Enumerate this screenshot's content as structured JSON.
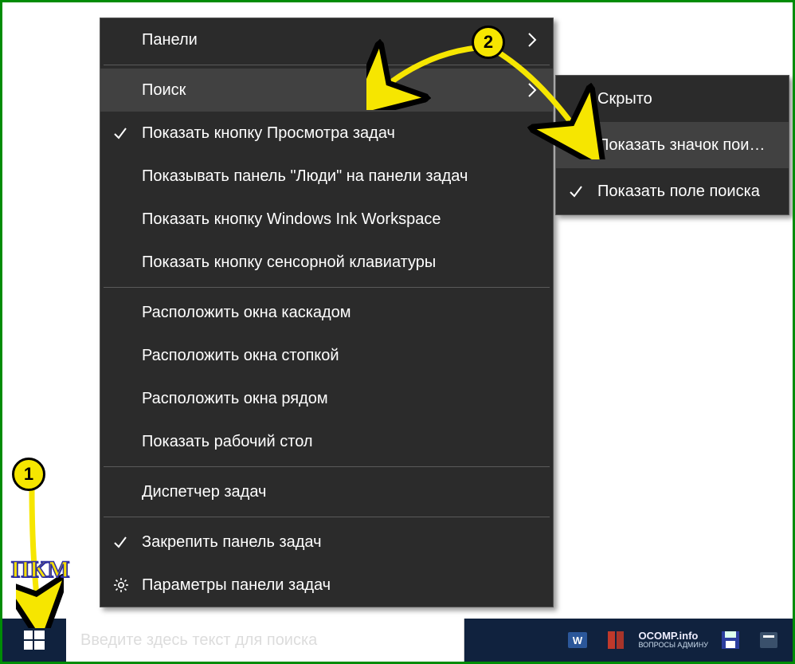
{
  "context_menu": {
    "items": [
      {
        "label": "Панели",
        "has_submenu": true
      },
      {
        "sep": true
      },
      {
        "label": "Поиск",
        "has_submenu": true,
        "hovered": true
      },
      {
        "label": "Показать кнопку Просмотра задач",
        "checked": true
      },
      {
        "label": "Показывать панель \"Люди\" на панели задач"
      },
      {
        "label": "Показать кнопку Windows Ink Workspace"
      },
      {
        "label": "Показать кнопку сенсорной клавиатуры"
      },
      {
        "sep": true
      },
      {
        "label": "Расположить окна каскадом"
      },
      {
        "label": "Расположить окна стопкой"
      },
      {
        "label": "Расположить окна рядом"
      },
      {
        "label": "Показать рабочий стол"
      },
      {
        "sep": true
      },
      {
        "label": "Диспетчер задач"
      },
      {
        "sep": true
      },
      {
        "label": "Закрепить панель задач",
        "checked": true
      },
      {
        "label": "Параметры панели задач",
        "icon": "gear"
      }
    ]
  },
  "submenu": {
    "items": [
      {
        "label": "Скрыто"
      },
      {
        "label": "Показать значок поиска",
        "hovered": true
      },
      {
        "label": "Показать поле поиска",
        "checked": true
      }
    ]
  },
  "taskbar": {
    "search_placeholder": "Введите здесь текст для поиска"
  },
  "annotations": {
    "badge1": "1",
    "badge2": "2",
    "pkm": "ПКМ"
  },
  "watermark": {
    "line1": "OCOMP.info",
    "line2": "ВОПРОСЫ АДМИНУ"
  }
}
